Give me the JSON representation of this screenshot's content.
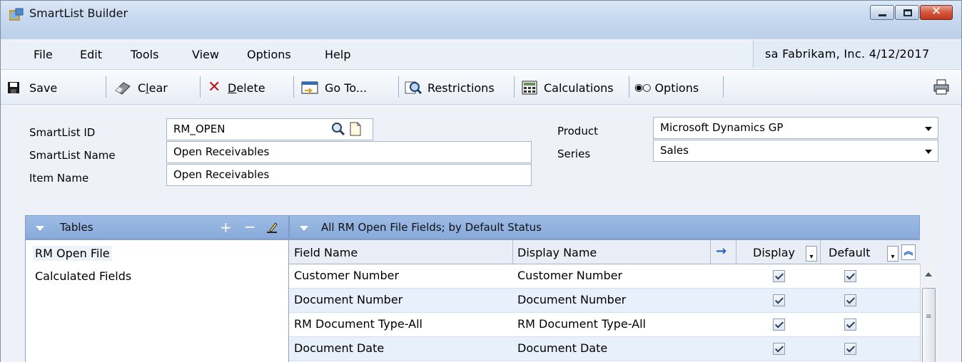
{
  "window": {
    "title": "SmartList Builder"
  },
  "menu": {
    "items": [
      "File",
      "Edit",
      "Tools",
      "View",
      "Options",
      "Help"
    ],
    "company_info": "sa  Fabrikam, Inc.  4/12/2017"
  },
  "toolbar": {
    "save": "Save",
    "clear_pre": "C",
    "clear_u": "l",
    "clear_post": "ear",
    "delete_u": "D",
    "delete_post": "elete",
    "goto": "Go To...",
    "restrictions": "Restrictions",
    "calculations": "Calculations",
    "options": "Options"
  },
  "form": {
    "smartlist_id_label": "SmartList ID",
    "smartlist_id": "RM_OPEN",
    "smartlist_name_label": "SmartList Name",
    "smartlist_name": "Open Receivables",
    "item_name_label": "Item Name",
    "item_name": "Open Receivables",
    "product_label": "Product",
    "product": "Microsoft Dynamics GP",
    "series_label": "Series",
    "series": "Sales"
  },
  "tables_panel": {
    "title": "Tables",
    "items": [
      "RM Open File",
      "Calculated Fields"
    ],
    "selected": "RM Open File"
  },
  "fields_panel": {
    "title": "All RM Open File Fields; by Default Status",
    "columns": {
      "field_name": "Field Name",
      "display_name": "Display Name",
      "display": "Display",
      "default": "Default"
    },
    "rows": [
      {
        "field": "Customer Number",
        "display_name": "Customer Number",
        "display": true,
        "default": true
      },
      {
        "field": "Document Number",
        "display_name": "Document Number",
        "display": true,
        "default": true
      },
      {
        "field": "RM Document Type-All",
        "display_name": "RM Document Type-All",
        "display": true,
        "default": true
      },
      {
        "field": "Document Date",
        "display_name": "Document Date",
        "display": true,
        "default": true
      }
    ]
  },
  "colors": {
    "title_bar": "#c7d9ef",
    "panel_header": "#93b3df",
    "alt_row": "#e7f0fb",
    "close_button": "#d4563b"
  }
}
